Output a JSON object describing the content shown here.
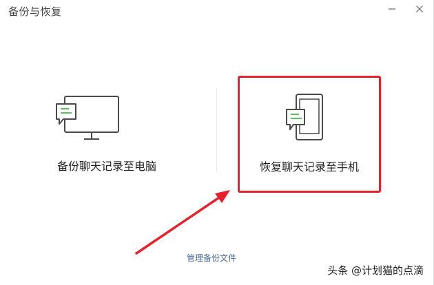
{
  "window": {
    "title": "备份与恢复",
    "minimize_icon": "minimize-icon",
    "close_icon": "close-icon"
  },
  "options": {
    "backup_pc": {
      "label": "备份聊天记录至电脑",
      "icon": "computer-chat-icon"
    },
    "restore_phone": {
      "label": "恢复聊天记录至手机",
      "icon": "phone-chat-icon"
    }
  },
  "footer": {
    "manage_label": "管理备份文件"
  },
  "watermark": {
    "text": "头条 @计划猫的点滴"
  },
  "colors": {
    "highlight": "#e8202a",
    "chat_green": "#59c15a",
    "link": "#4a6c9b",
    "icon_stroke": "#4a4a4a"
  }
}
